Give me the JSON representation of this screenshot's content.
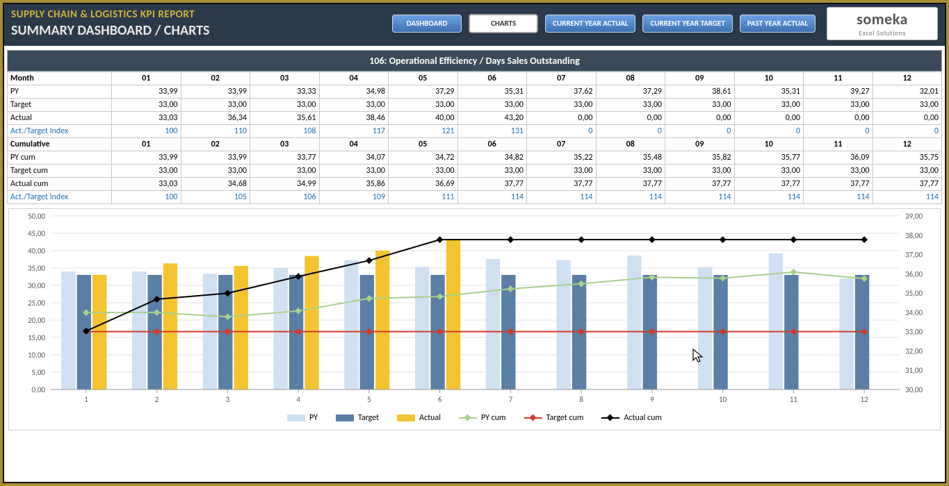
{
  "header": {
    "title": "SUPPLY CHAIN & LOGISTICS KPI REPORT",
    "subtitle": "SUMMARY DASHBOARD / CHARTS",
    "nav": {
      "dashboard": "DASHBOARD",
      "charts": "CHARTS",
      "cy_actual": "CURRENT YEAR ACTUAL",
      "cy_target": "CURRENT YEAR TARGET",
      "py_actual": "PAST YEAR ACTUAL"
    },
    "logo": {
      "brand": "someka",
      "tag": "Excel Solutions"
    }
  },
  "section_title": "106: Operational Efficiency / Days Sales Outstanding",
  "table": {
    "months_label": "Month",
    "months": [
      "01",
      "02",
      "03",
      "04",
      "05",
      "06",
      "07",
      "08",
      "09",
      "10",
      "11",
      "12"
    ],
    "rows": {
      "py": {
        "label": "PY",
        "vals": [
          "33,99",
          "33,99",
          "33,33",
          "34,98",
          "37,29",
          "35,31",
          "37,62",
          "37,29",
          "38,61",
          "35,31",
          "39,27",
          "32,01"
        ]
      },
      "target": {
        "label": "Target",
        "vals": [
          "33,00",
          "33,00",
          "33,00",
          "33,00",
          "33,00",
          "33,00",
          "33,00",
          "33,00",
          "33,00",
          "33,00",
          "33,00",
          "33,00"
        ]
      },
      "actual": {
        "label": "Actual",
        "vals": [
          "33,03",
          "36,34",
          "35,61",
          "38,46",
          "40,00",
          "43,20",
          "0,00",
          "0,00",
          "0,00",
          "0,00",
          "0,00",
          "0,00"
        ]
      },
      "idx": {
        "label": "Act./Target Index",
        "vals": [
          "100",
          "110",
          "108",
          "117",
          "121",
          "131",
          "0",
          "0",
          "0",
          "0",
          "0",
          "0"
        ]
      }
    },
    "cum_label": "Cumulative",
    "cum": {
      "pycum": {
        "label": "PY cum",
        "vals": [
          "33,99",
          "33,99",
          "33,77",
          "34,07",
          "34,72",
          "34,82",
          "35,22",
          "35,48",
          "35,82",
          "35,77",
          "36,09",
          "35,75"
        ]
      },
      "tgtcum": {
        "label": "Target cum",
        "vals": [
          "33,00",
          "33,00",
          "33,00",
          "33,00",
          "33,00",
          "33,00",
          "33,00",
          "33,00",
          "33,00",
          "33,00",
          "33,00",
          "33,00"
        ]
      },
      "actcum": {
        "label": "Actual cum",
        "vals": [
          "33,03",
          "34,68",
          "34,99",
          "35,86",
          "36,69",
          "37,77",
          "37,77",
          "37,77",
          "37,77",
          "37,77",
          "37,77",
          "37,77"
        ]
      },
      "idxcum": {
        "label": "Act./Target Index",
        "vals": [
          "100",
          "105",
          "106",
          "109",
          "111",
          "114",
          "114",
          "114",
          "114",
          "114",
          "114",
          "114"
        ]
      }
    }
  },
  "legend": {
    "py": "PY",
    "target": "Target",
    "actual": "Actual",
    "pycum": "PY cum",
    "tgtcum": "Target cum",
    "actcum": "Actual cum"
  },
  "chart_data": {
    "type": "bar+line",
    "categories": [
      1,
      2,
      3,
      4,
      5,
      6,
      7,
      8,
      9,
      10,
      11,
      12
    ],
    "left_axis": {
      "min": 0,
      "max": 50,
      "step": 5,
      "labels": [
        "0,00",
        "5,00",
        "10,00",
        "15,00",
        "20,00",
        "25,00",
        "30,00",
        "35,00",
        "40,00",
        "45,00",
        "50,00"
      ]
    },
    "right_axis": {
      "min": 30,
      "max": 39,
      "step": 1,
      "labels": [
        "30,00",
        "31,00",
        "32,00",
        "33,00",
        "34,00",
        "35,00",
        "36,00",
        "37,00",
        "38,00",
        "39,00"
      ]
    },
    "bars": [
      {
        "name": "PY",
        "color": "#cfe0f2",
        "values": [
          33.99,
          33.99,
          33.33,
          34.98,
          37.29,
          35.31,
          37.62,
          37.29,
          38.61,
          35.31,
          39.27,
          32.01
        ]
      },
      {
        "name": "Target",
        "color": "#5a7fa6",
        "values": [
          33.0,
          33.0,
          33.0,
          33.0,
          33.0,
          33.0,
          33.0,
          33.0,
          33.0,
          33.0,
          33.0,
          33.0
        ]
      },
      {
        "name": "Actual",
        "color": "#f4c430",
        "values": [
          33.03,
          36.34,
          35.61,
          38.46,
          40.0,
          43.2,
          0,
          0,
          0,
          0,
          0,
          0
        ]
      }
    ],
    "lines": [
      {
        "name": "PY cum",
        "color": "#a7d08c",
        "marker": "diamond",
        "values": [
          33.99,
          33.99,
          33.77,
          34.07,
          34.72,
          34.82,
          35.22,
          35.48,
          35.82,
          35.77,
          36.09,
          35.75
        ]
      },
      {
        "name": "Target cum",
        "color": "#d23a2a",
        "marker": "diamond",
        "values": [
          33.0,
          33.0,
          33.0,
          33.0,
          33.0,
          33.0,
          33.0,
          33.0,
          33.0,
          33.0,
          33.0,
          33.0
        ]
      },
      {
        "name": "Actual cum",
        "color": "#000000",
        "marker": "diamond",
        "values": [
          33.03,
          34.68,
          34.99,
          35.86,
          36.69,
          37.77,
          37.77,
          37.77,
          37.77,
          37.77,
          37.77,
          37.77
        ]
      }
    ]
  }
}
